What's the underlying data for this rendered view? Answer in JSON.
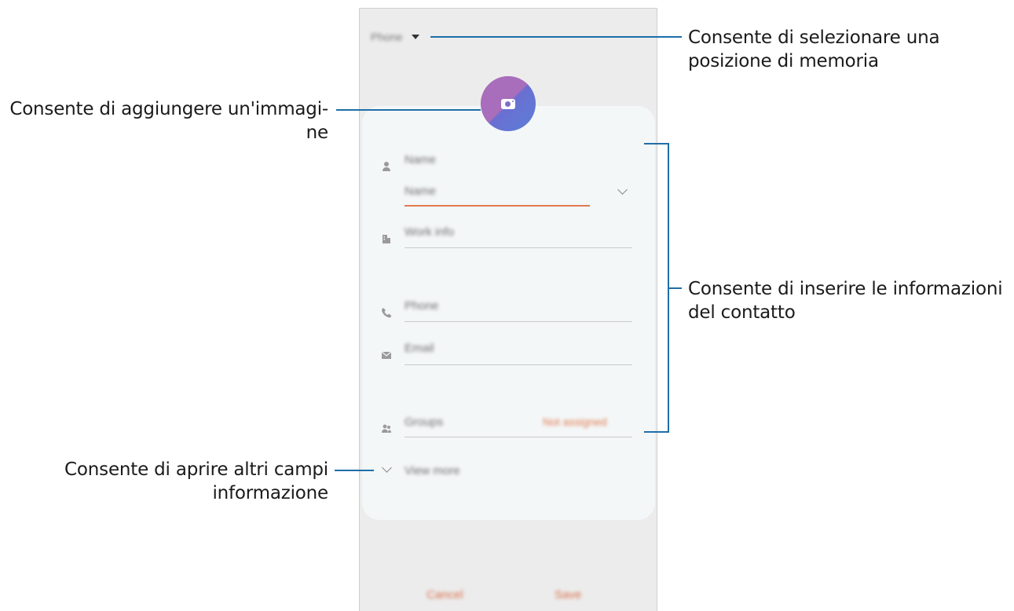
{
  "callouts": {
    "storage": [
      "Consente di selezionare una",
      "posizione di memoria"
    ],
    "image": [
      "Consente di aggiungere un'immagi-",
      "ne"
    ],
    "info": [
      "Consente di inserire le informazioni",
      "del contatto"
    ],
    "more": [
      "Consente di aprire altri campi",
      "informazione"
    ]
  },
  "screen": {
    "storage_label": "Phone",
    "fields": {
      "name": "Name",
      "name_sub": "Name",
      "work": "Work info",
      "phone": "Phone",
      "email": "Email",
      "groups": "Groups",
      "groups_value": "Not assigned",
      "view_more": "View more"
    },
    "footer": {
      "cancel": "Cancel",
      "save": "Save"
    }
  },
  "colors": {
    "accent": "#1f6ea8",
    "underline_active": "#e07a4f",
    "button_text": "#d9704a"
  }
}
